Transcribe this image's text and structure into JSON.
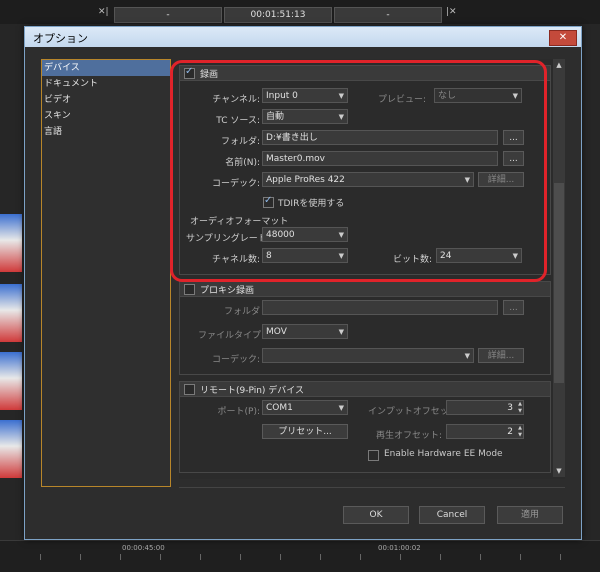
{
  "background": {
    "timecode_left": "-",
    "timecode_center": "00:01:51:13",
    "timecode_right": "-",
    "ruler": [
      "00:00:45:00",
      "00:01:00:02"
    ]
  },
  "dialog": {
    "title": "オプション",
    "close_glyph": "✕",
    "categories": [
      "デバイス",
      "ドキュメント",
      "ビデオ",
      "スキン",
      "言語"
    ],
    "selected_category": "デバイス",
    "buttons": {
      "ok": "OK",
      "cancel": "Cancel",
      "apply": "適用"
    }
  },
  "recording": {
    "header": "録画",
    "checked": true,
    "channel_label": "チャンネル:",
    "channel_value": "Input 0",
    "preview_label": "プレビュー:",
    "preview_value": "なし",
    "tc_source_label": "TC ソース:",
    "tc_source_value": "自動",
    "folder_label": "フォルダ:",
    "folder_value": "D:¥書き出し",
    "browse_label": "...",
    "name_label": "名前(N):",
    "name_value": "Master0.mov",
    "codec_label": "コーデック:",
    "codec_value": "Apple ProRes 422",
    "detail_label": "詳細...",
    "tdir_label": "TDIRを使用する",
    "tdir_checked": true,
    "audio_format_label": "オーディオフォーマット",
    "sample_rate_label": "サンプリングレート:",
    "sample_rate_value": "48000",
    "channels_label": "チャネル数:",
    "channels_value": "8",
    "bits_label": "ビット数:",
    "bits_value": "24"
  },
  "proxy": {
    "header": "プロキシ録画",
    "checked": false,
    "folder_label": "フォルダ",
    "folder_value": "",
    "browse_label": "...",
    "filetype_label": "ファイルタイプ:",
    "filetype_value": "MOV",
    "codec_label": "コーデック:",
    "codec_value": "",
    "detail_label": "詳細..."
  },
  "remote": {
    "header": "リモート(9-Pin) デバイス",
    "checked": false,
    "port_label": "ポート(P):",
    "port_value": "COM1",
    "preset_label": "プリセット...",
    "input_offset_label": "インプットオフセット:",
    "input_offset_value": "3",
    "play_offset_label": "再生オフセット:",
    "play_offset_value": "2",
    "hw_ee_label": "Enable Hardware EE Mode",
    "hw_ee_checked": false
  },
  "colors": {
    "highlight": "#e0232a",
    "selection": "#4f6f9d",
    "titlebar": "#c3d8ee"
  }
}
